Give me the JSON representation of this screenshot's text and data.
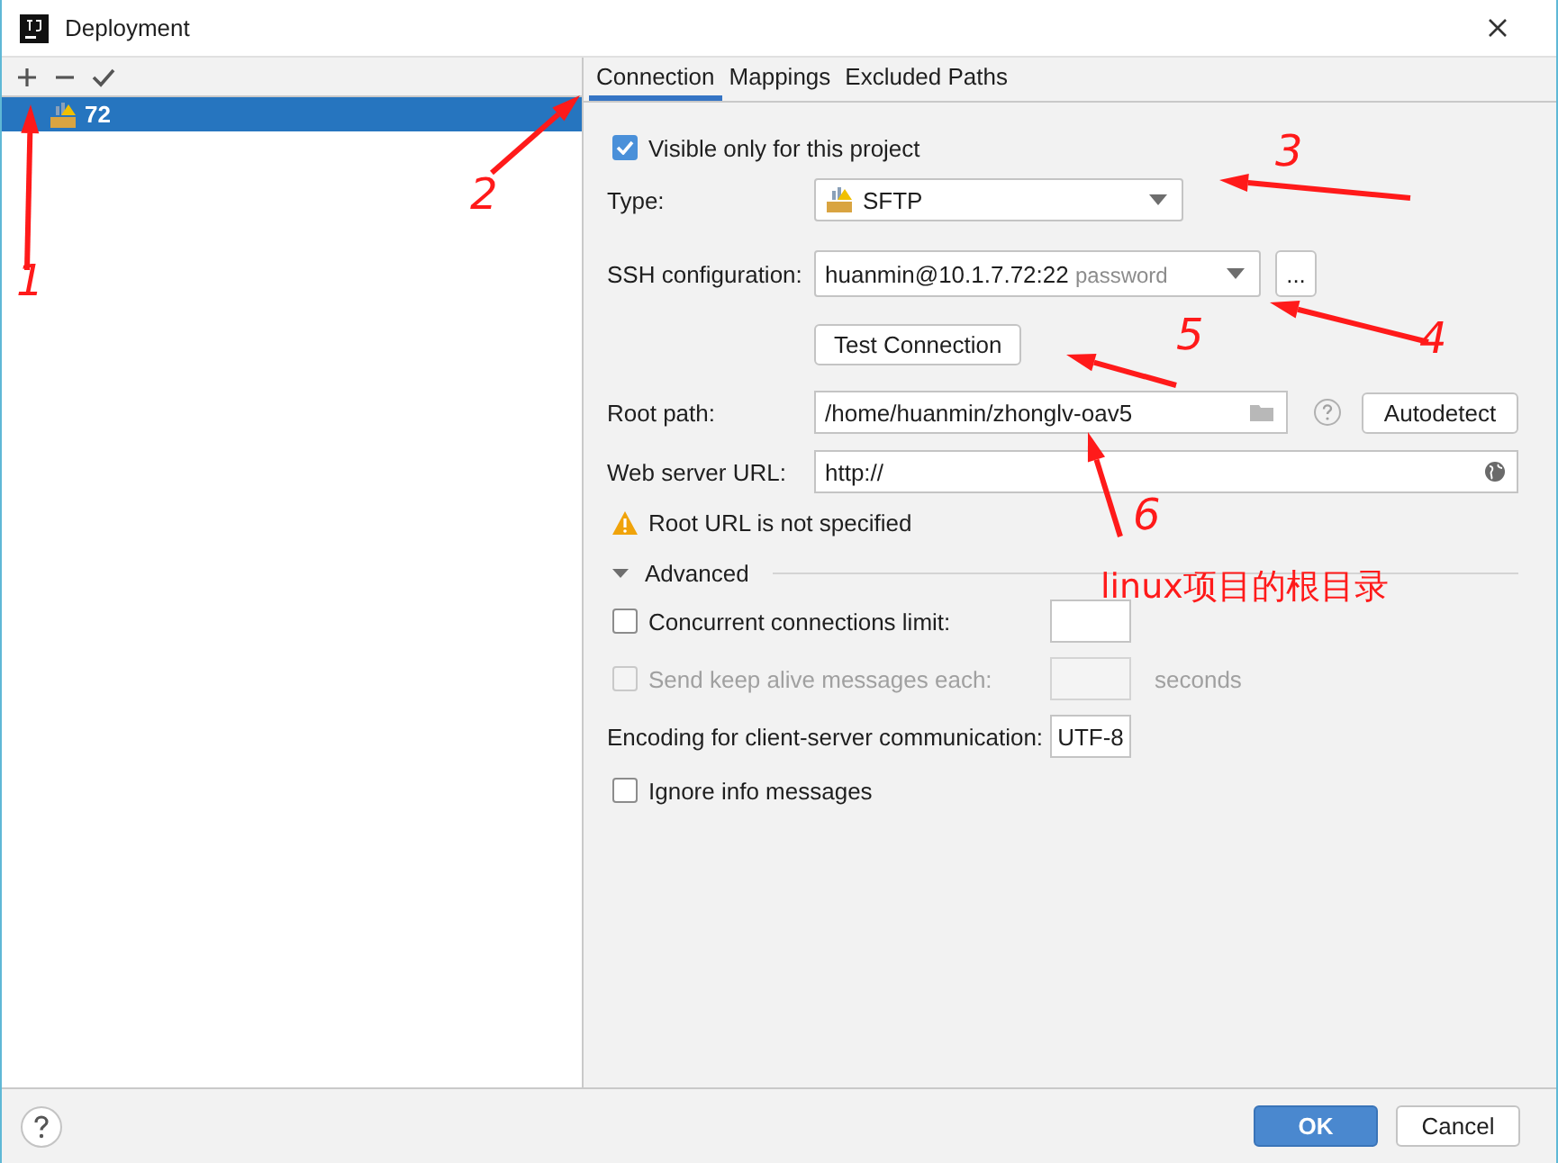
{
  "window": {
    "title": "Deployment"
  },
  "servers": [
    {
      "name": "72",
      "selected": true
    }
  ],
  "tabs": [
    {
      "label": "Connection",
      "selected": true
    },
    {
      "label": "Mappings",
      "selected": false
    },
    {
      "label": "Excluded Paths",
      "selected": false
    }
  ],
  "visible_only": {
    "label": "Visible only for this project",
    "checked": true
  },
  "type": {
    "label": "Type:",
    "value": "SFTP"
  },
  "ssh": {
    "label": "SSH configuration:",
    "value": "huanmin@10.1.7.72:22",
    "hint": "password",
    "more": "..."
  },
  "test_button": "Test Connection",
  "root_path": {
    "label": "Root path:",
    "value": "/home/huanmin/zhonglv-oav5",
    "action": "Autodetect"
  },
  "web_url": {
    "label": "Web server URL:",
    "value": "http://"
  },
  "warning": "Root URL is not specified",
  "advanced": {
    "label": "Advanced",
    "expanded": true
  },
  "options": [
    {
      "kind": "checkbox_field",
      "label": "Concurrent connections limit:",
      "checked": false,
      "disabled": false
    },
    {
      "kind": "checkbox_field",
      "label": "Send keep alive messages each:",
      "checked": false,
      "disabled": true,
      "suffix": "seconds"
    },
    {
      "kind": "field",
      "label": "Encoding for client-server communication:",
      "value": "UTF-8"
    },
    {
      "kind": "checkbox",
      "label": "Ignore info messages",
      "checked": false,
      "disabled": false
    }
  ],
  "buttons": [
    {
      "label": "OK",
      "kind": "primary"
    },
    {
      "label": "Cancel",
      "kind": "default"
    }
  ],
  "annotations": {
    "markers": [
      "1",
      "2",
      "3",
      "4",
      "5",
      "6"
    ],
    "note": "linux项目的根目录"
  }
}
